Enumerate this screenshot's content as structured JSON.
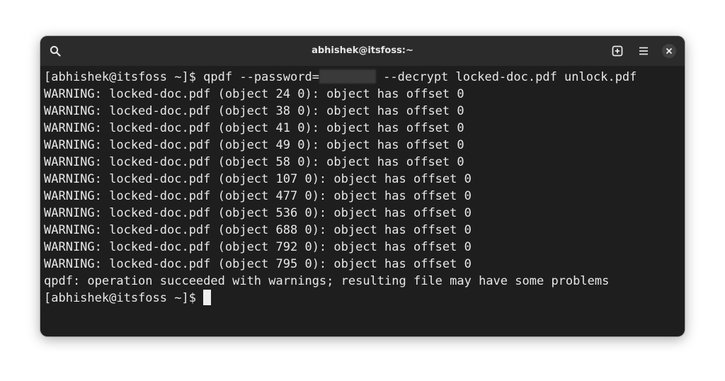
{
  "window": {
    "title": "abhishek@itsfoss:~"
  },
  "icons": {
    "search": "search-icon",
    "new_tab": "new-tab-icon",
    "menu": "hamburger-menu-icon",
    "close": "close-icon"
  },
  "terminal": {
    "command": {
      "prompt": "[abhishek@itsfoss ~]$ ",
      "before_redaction": "qpdf --password=",
      "after_redaction": " --decrypt locked-doc.pdf unlock.pdf"
    },
    "output": [
      "WARNING: locked-doc.pdf (object 24 0): object has offset 0",
      "WARNING: locked-doc.pdf (object 38 0): object has offset 0",
      "WARNING: locked-doc.pdf (object 41 0): object has offset 0",
      "WARNING: locked-doc.pdf (object 49 0): object has offset 0",
      "WARNING: locked-doc.pdf (object 58 0): object has offset 0",
      "WARNING: locked-doc.pdf (object 107 0): object has offset 0",
      "WARNING: locked-doc.pdf (object 477 0): object has offset 0",
      "WARNING: locked-doc.pdf (object 536 0): object has offset 0",
      "WARNING: locked-doc.pdf (object 688 0): object has offset 0",
      "WARNING: locked-doc.pdf (object 792 0): object has offset 0",
      "WARNING: locked-doc.pdf (object 795 0): object has offset 0",
      "qpdf: operation succeeded with warnings; resulting file may have some problems"
    ],
    "final_prompt": "[abhishek@itsfoss ~]$ "
  },
  "colors": {
    "terminal_bg": "#1e1e1e",
    "titlebar_bg": "#2b2b2b",
    "text": "#e8e8e8"
  }
}
